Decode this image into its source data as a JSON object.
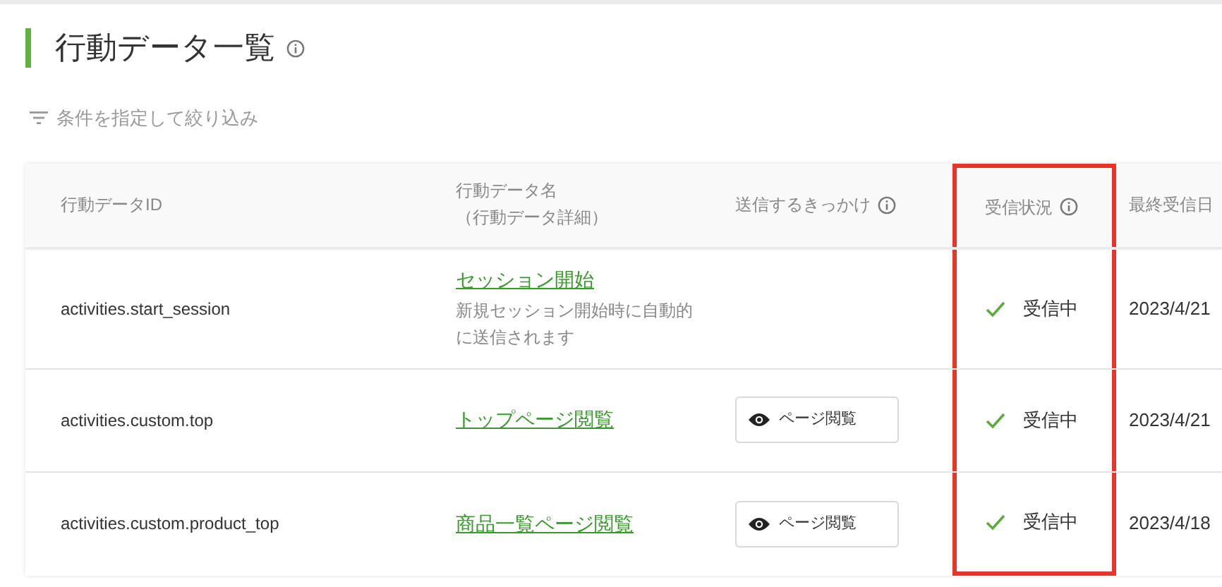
{
  "page": {
    "title": "行動データ一覧"
  },
  "filter": {
    "label": "条件を指定して絞り込み"
  },
  "table": {
    "columns": [
      {
        "label": "行動データID",
        "info": false,
        "highlighted": false
      },
      {
        "label": "行動データ名",
        "sublabel": "（行動データ詳細）",
        "info": false,
        "highlighted": false
      },
      {
        "label": "送信するきっかけ",
        "info": true,
        "highlighted": false
      },
      {
        "label": "受信状況",
        "info": true,
        "highlighted": true
      },
      {
        "label": "最終受信日",
        "info": false,
        "highlighted": false
      }
    ],
    "rows": [
      {
        "id": "activities.start_session",
        "name": "セッション開始",
        "description": "新規セッション開始時に自動的に送信されます",
        "status": {
          "label": "受信中",
          "kind": "ok"
        },
        "last_received": "2023/4/21"
      },
      {
        "id": "activities.custom.top",
        "name": "トップページ閲覧",
        "trigger": {
          "label": "ページ閲覧",
          "kind": "page_view"
        },
        "status": {
          "label": "受信中",
          "kind": "ok"
        },
        "last_received": "2023/4/21"
      },
      {
        "id": "activities.custom.product_top",
        "name": "商品一覧ページ閲覧",
        "trigger": {
          "label": "ページ閲覧",
          "kind": "page_view"
        },
        "status": {
          "label": "受信中",
          "kind": "ok"
        },
        "last_received": "2023/4/18"
      }
    ]
  }
}
